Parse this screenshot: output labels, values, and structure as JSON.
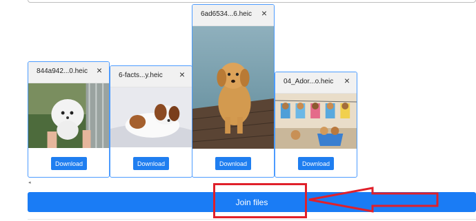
{
  "files": [
    {
      "name": "844a942...0.heic",
      "close": "×",
      "download_label": "Download"
    },
    {
      "name": "6-facts...y.heic",
      "close": "×",
      "download_label": "Download"
    },
    {
      "name": "6ad6534...6.heic",
      "close": "×",
      "download_label": "Download"
    },
    {
      "name": "04_Ador...o.heic",
      "close": "×",
      "download_label": "Download"
    }
  ],
  "scrollbar": {
    "left_arrow": "◂"
  },
  "join_button": {
    "label": "Join files"
  },
  "annotation": {
    "color": "#e0202a"
  },
  "colors": {
    "accent": "#1a7cf5",
    "card_border": "#4b9bff"
  }
}
